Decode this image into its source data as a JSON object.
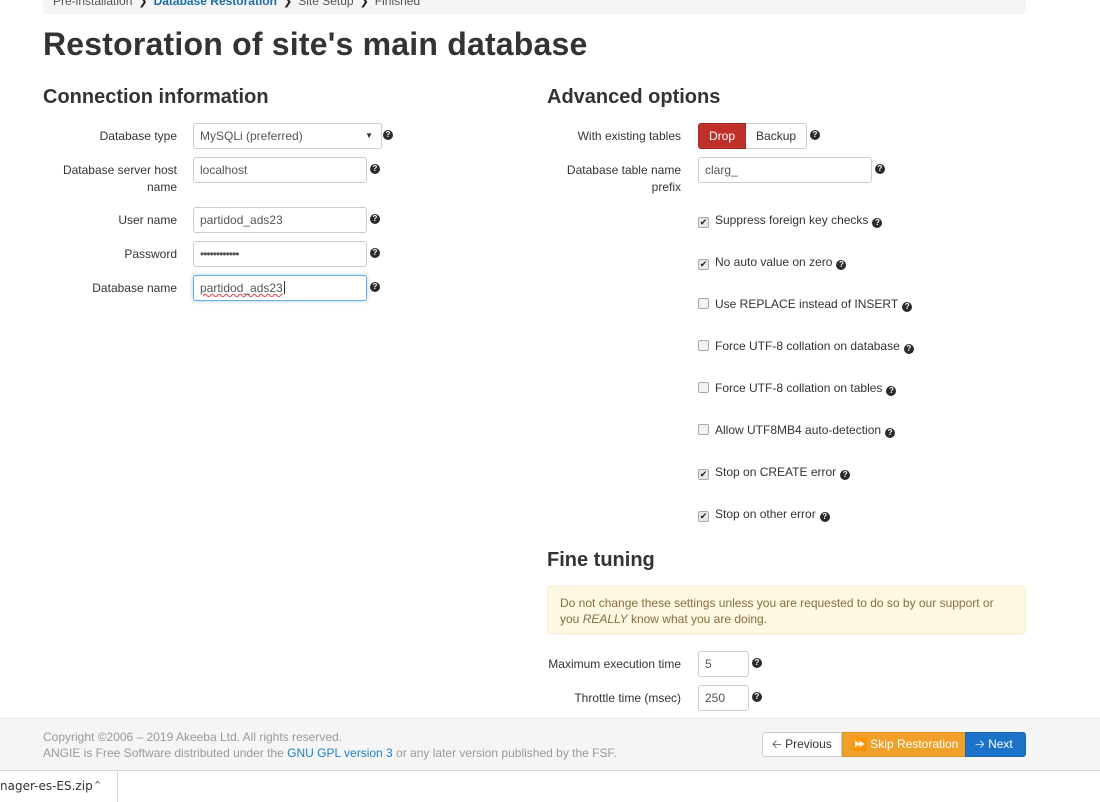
{
  "breadcrumb": [
    "Pre-installation",
    "Database Restoration",
    "Site Setup",
    "Finished"
  ],
  "page_title": "Restoration of site's main database",
  "connection": {
    "heading": "Connection information",
    "db_type_label": "Database type",
    "db_type_value": "MySQLi (preferred)",
    "host_label_1": "Database server host",
    "host_label_2": "name",
    "host_value": "localhost",
    "user_label": "User name",
    "user_value": "partidod_ads23",
    "password_label": "Password",
    "password_value": "••••••••••••",
    "dbname_label": "Database name",
    "dbname_value": "partidod_ads23"
  },
  "advanced": {
    "heading": "Advanced options",
    "existing_label": "With existing tables",
    "drop_label": "Drop",
    "backup_label": "Backup",
    "prefix_label_1": "Database table name",
    "prefix_label_2": "prefix",
    "prefix_value": "clarg_",
    "checkboxes": [
      {
        "label": "Suppress foreign key checks",
        "checked": true
      },
      {
        "label": "No auto value on zero",
        "checked": true
      },
      {
        "label": "Use REPLACE instead of INSERT",
        "checked": false
      },
      {
        "label": "Force UTF-8 collation on database",
        "checked": false
      },
      {
        "label": "Force UTF-8 collation on tables",
        "checked": false
      },
      {
        "label": "Allow UTF8MB4 auto-detection",
        "checked": false
      },
      {
        "label": "Stop on CREATE error",
        "checked": true
      },
      {
        "label": "Stop on other error",
        "checked": true
      }
    ]
  },
  "fine_tuning": {
    "heading": "Fine tuning",
    "warning_pre": "Do not change these settings unless you are requested to do so by our support or you ",
    "warning_em": "REALLY",
    "warning_post": " know what you are doing.",
    "max_exec_label": "Maximum execution time",
    "max_exec_value": "5",
    "throttle_label": "Throttle time (msec)",
    "throttle_value": "250"
  },
  "footer": {
    "copyright": "Copyright ©2006 – 2019 Akeeba Ltd. All rights reserved.",
    "license_pre": "ANGIE is Free Software distributed under the ",
    "license_link": "GNU GPL version 3",
    "license_post": " or any later version published by the FSF."
  },
  "nav": {
    "previous": "Previous",
    "skip": "Skip Restoration",
    "next": "Next"
  },
  "download_bar": {
    "file": "nager-es-ES.zip"
  }
}
